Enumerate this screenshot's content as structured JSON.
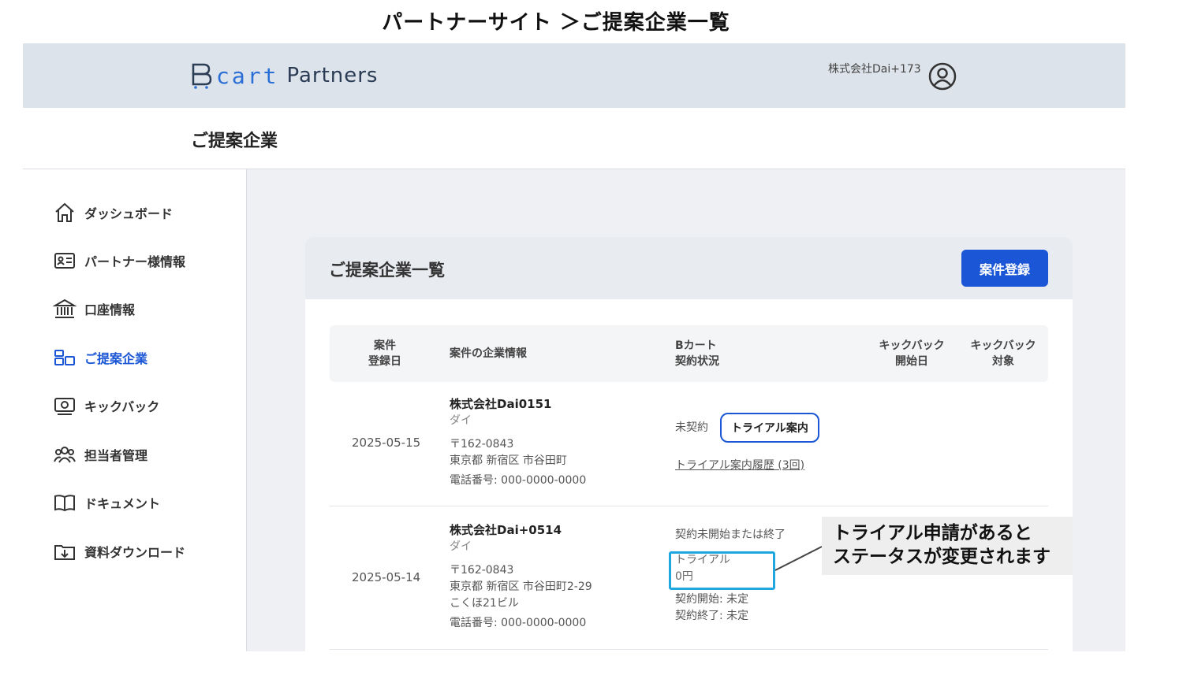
{
  "caption": "パートナーサイト ＞ご提案企業一覧",
  "header": {
    "logo_cart": "cart",
    "logo_partners": "Partners",
    "company_name": "株式会社Dai+173",
    "user_icon": "user-circle-icon"
  },
  "page_title": "ご提案企業",
  "sidebar": {
    "items": [
      {
        "label": "ダッシュボード",
        "icon": "home-icon",
        "active": false
      },
      {
        "label": "パートナー様情報",
        "icon": "id-card-icon",
        "active": false
      },
      {
        "label": "口座情報",
        "icon": "bank-icon",
        "active": false
      },
      {
        "label": "ご提案企業",
        "icon": "proposal-icon",
        "active": true
      },
      {
        "label": "キックバック",
        "icon": "money-icon",
        "active": false
      },
      {
        "label": "担当者管理",
        "icon": "users-icon",
        "active": false
      },
      {
        "label": "ドキュメント",
        "icon": "book-icon",
        "active": false
      },
      {
        "label": "資料ダウンロード",
        "icon": "download-icon",
        "active": false
      }
    ]
  },
  "card": {
    "title": "ご提案企業一覧",
    "register_label": "案件登録"
  },
  "table": {
    "headers": {
      "registered_1": "案件",
      "registered_2": "登録日",
      "company_info": "案件の企業情報",
      "status_1": "Bカート",
      "status_2": "契約状況",
      "kickback_start_1": "キックバック",
      "kickback_start_2": "開始日",
      "kickback_target_1": "キックバック",
      "kickback_target_2": "対象"
    },
    "rows": [
      {
        "date": "2025-05-15",
        "company": "株式会社Dai0151",
        "kana": "ダイ",
        "zip": "〒162-0843",
        "address": "東京都 新宿区 市谷田町",
        "phone": "電話番号: 000-0000-0000",
        "status": "未契約",
        "trial_button": "トライアル案内",
        "history_link": "トライアル案内履歴 (3回)"
      },
      {
        "date": "2025-05-14",
        "company": "株式会社Dai+0514",
        "kana": "ダイ",
        "zip": "〒162-0843",
        "address": "東京都 新宿区 市谷田町2-29",
        "building": "こくほ21ビル",
        "phone": "電話番号: 000-0000-0000",
        "status": "契約未開始または終了",
        "plan": "トライアル",
        "price": "0円",
        "contract_start": "契約開始: 未定",
        "contract_end": "契約終了: 未定"
      }
    ]
  },
  "callout": {
    "line1": "トライアル申請があると",
    "line2": "ステータスが変更されます"
  },
  "colors": {
    "accent": "#1a56d6",
    "highlight": "#1fa8e0",
    "header_bg": "#dde3ea"
  }
}
